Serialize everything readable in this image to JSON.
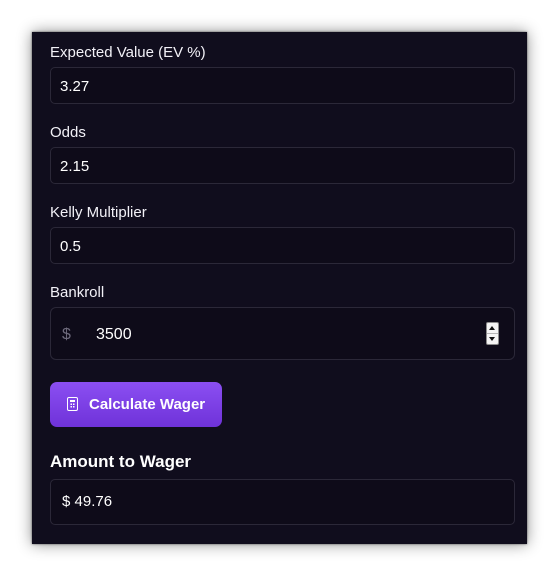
{
  "form": {
    "ev": {
      "label": "Expected Value (EV %)",
      "value": "3.27"
    },
    "odds": {
      "label": "Odds",
      "value": "2.15"
    },
    "kelly": {
      "label": "Kelly Multiplier",
      "value": "0.5"
    },
    "bankroll": {
      "label": "Bankroll",
      "currency_symbol": "$",
      "value": "3500"
    }
  },
  "calculate_button": {
    "label": "Calculate Wager",
    "icon": "calculator-icon"
  },
  "result": {
    "heading": "Amount to Wager",
    "value": "$ 49.76"
  },
  "colors": {
    "background": "#100d1d",
    "field_border": "#2b2838",
    "accent": "#7b3ff0"
  }
}
